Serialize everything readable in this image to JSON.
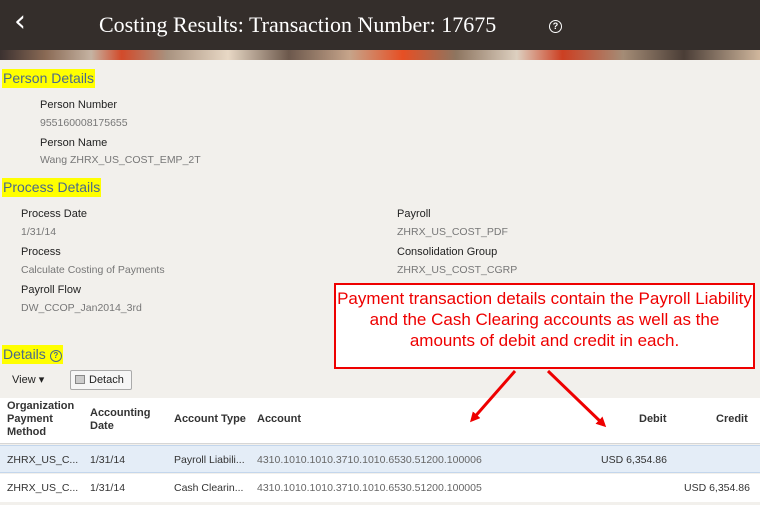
{
  "header": {
    "back_icon": "chevron-left-icon",
    "title": "Costing Results: Transaction Number: 17675",
    "help_symbol": "?"
  },
  "person_details": {
    "heading": "Person Details",
    "fields": [
      {
        "label": "Person Number",
        "value": "955160008175655"
      },
      {
        "label": "Person Name",
        "value": "Wang ZHRX_US_COST_EMP_2T"
      }
    ]
  },
  "process_details": {
    "heading": "Process Details",
    "left": [
      {
        "label": "Process Date",
        "value": "1/31/14"
      },
      {
        "label": "Process",
        "value": "Calculate Costing of Payments"
      },
      {
        "label": "Payroll Flow",
        "value": "DW_CCOP_Jan2014_3rd"
      }
    ],
    "right": [
      {
        "label": "Payroll",
        "value": "ZHRX_US_COST_PDF"
      },
      {
        "label": "Consolidation Group",
        "value": "ZHRX_US_COST_CGRP"
      }
    ]
  },
  "details": {
    "heading": "Details",
    "help_symbol": "?",
    "view_label": "View ▾",
    "detach_label": "Detach",
    "columns": {
      "org_payment_method": "Organization Payment Method",
      "accounting_date": "Accounting Date",
      "account_type": "Account Type",
      "account": "Account",
      "debit": "Debit",
      "credit": "Credit"
    },
    "rows": [
      {
        "org_payment_method": "ZHRX_US_C...",
        "accounting_date": "1/31/14",
        "account_type": "Payroll Liabili...",
        "account": "4310.1010.1010.3710.1010.6530.51200.100006",
        "debit": "USD 6,354.86",
        "credit": ""
      },
      {
        "org_payment_method": "ZHRX_US_C...",
        "accounting_date": "1/31/14",
        "account_type": "Cash Clearin...",
        "account": "4310.1010.1010.3710.1010.6530.51200.100005",
        "debit": "",
        "credit": "USD 6,354.86"
      }
    ]
  },
  "callout": {
    "text": "Payment transaction details contain the Payroll Liability and the Cash Clearing accounts as well as the amounts of debit and credit in each.",
    "color": "#ee0000"
  },
  "colors": {
    "header_bg": "#342e2b",
    "highlight": "#ffff00",
    "section_text": "#4a6a8a",
    "selected_row": "#e4edf7"
  }
}
